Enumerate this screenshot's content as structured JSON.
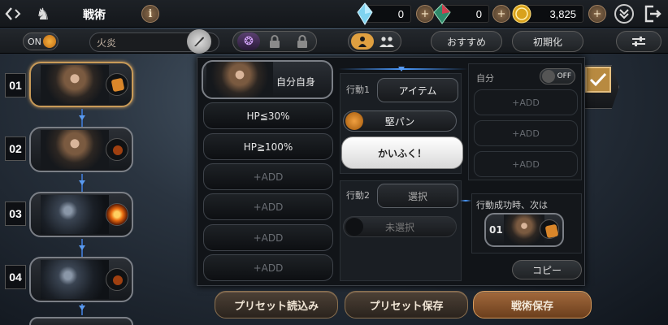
{
  "header": {
    "title": "戦術",
    "info_icon": "i",
    "currencies": [
      {
        "icon": "blue-crystal-icon",
        "value": "0"
      },
      {
        "icon": "red-green-crystal-icon",
        "value": "0"
      },
      {
        "icon": "gold-coin-icon",
        "value": "3,825"
      }
    ]
  },
  "toolbar": {
    "toggle_label": "ON",
    "preset_name": "火炎",
    "recommend_label": "おすすめ",
    "reset_label": "初期化"
  },
  "slots": [
    {
      "number": "01",
      "kind": "hero",
      "item": "bread",
      "active": true
    },
    {
      "number": "02",
      "kind": "hero",
      "item": "dim",
      "active": false
    },
    {
      "number": "03",
      "kind": "beast",
      "item": "fire",
      "active": false
    },
    {
      "number": "04",
      "kind": "beast",
      "item": "dim",
      "active": false
    }
  ],
  "conditions": {
    "target_label": "自分自身",
    "items": [
      "HP≦30%",
      "HP≧100%",
      "+ADD",
      "+ADD",
      "+ADD",
      "+ADD"
    ]
  },
  "actions": {
    "action1_label": "行動1",
    "action1_button": "アイテム",
    "item_name": "堅パン",
    "tooltip": "かいふく！",
    "action2_label": "行動2",
    "action2_button": "選択",
    "unselected_label": "未選択"
  },
  "self_panel": {
    "label": "自分",
    "toggle_label": "OFF",
    "adds": [
      "+ADD",
      "+ADD",
      "+ADD"
    ]
  },
  "next_panel": {
    "label": "行動成功時、次は",
    "slot_number": "01",
    "copy_label": "コピー"
  },
  "bottom": {
    "load_preset": "プリセット読込み",
    "save_preset": "プリセット保存",
    "save_tactics": "戦術保存"
  },
  "colors": {
    "accent_gold": "#c89a58",
    "primary_button": "#a2693c",
    "connector_blue": "#4a9aff",
    "toggle_on": "#e0962a"
  }
}
